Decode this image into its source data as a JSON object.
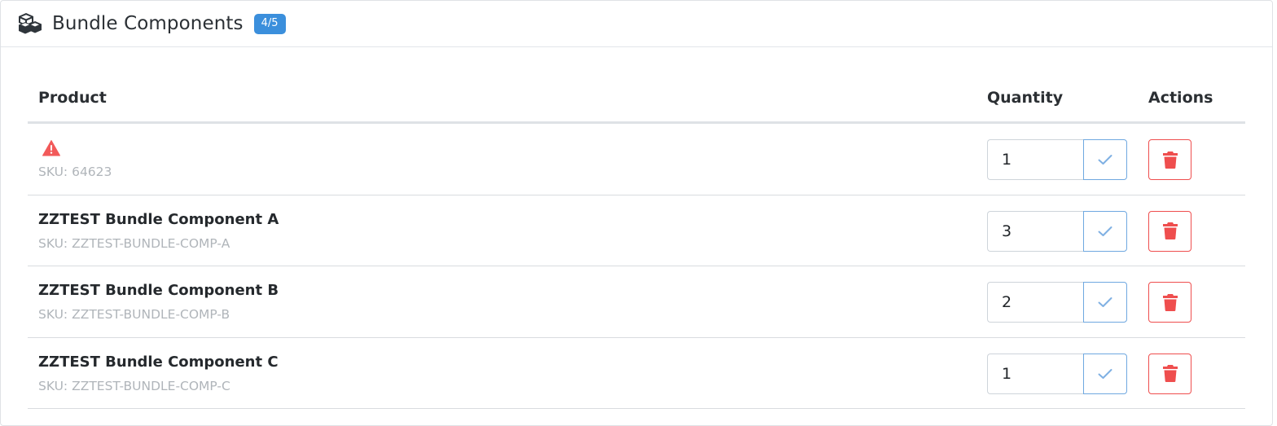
{
  "header": {
    "title": "Bundle Components",
    "badge": "4/5",
    "icon": "cubes-icon"
  },
  "table": {
    "columns": {
      "product": "Product",
      "quantity": "Quantity",
      "actions": "Actions"
    },
    "rows": [
      {
        "name": "",
        "warning": true,
        "sku": "SKU: 64623",
        "quantity": "1"
      },
      {
        "name": "ZZTEST Bundle Component A",
        "warning": false,
        "sku": "SKU: ZZTEST-BUNDLE-COMP-A",
        "quantity": "3"
      },
      {
        "name": "ZZTEST Bundle Component B",
        "warning": false,
        "sku": "SKU: ZZTEST-BUNDLE-COMP-B",
        "quantity": "2"
      },
      {
        "name": "ZZTEST Bundle Component C",
        "warning": false,
        "sku": "SKU: ZZTEST-BUNDLE-COMP-C",
        "quantity": "1"
      }
    ]
  },
  "colors": {
    "badge": "#3b8fdc",
    "danger": "#ef4e4e",
    "confirm": "#6fa8e0",
    "warning": "#f25a5a"
  }
}
